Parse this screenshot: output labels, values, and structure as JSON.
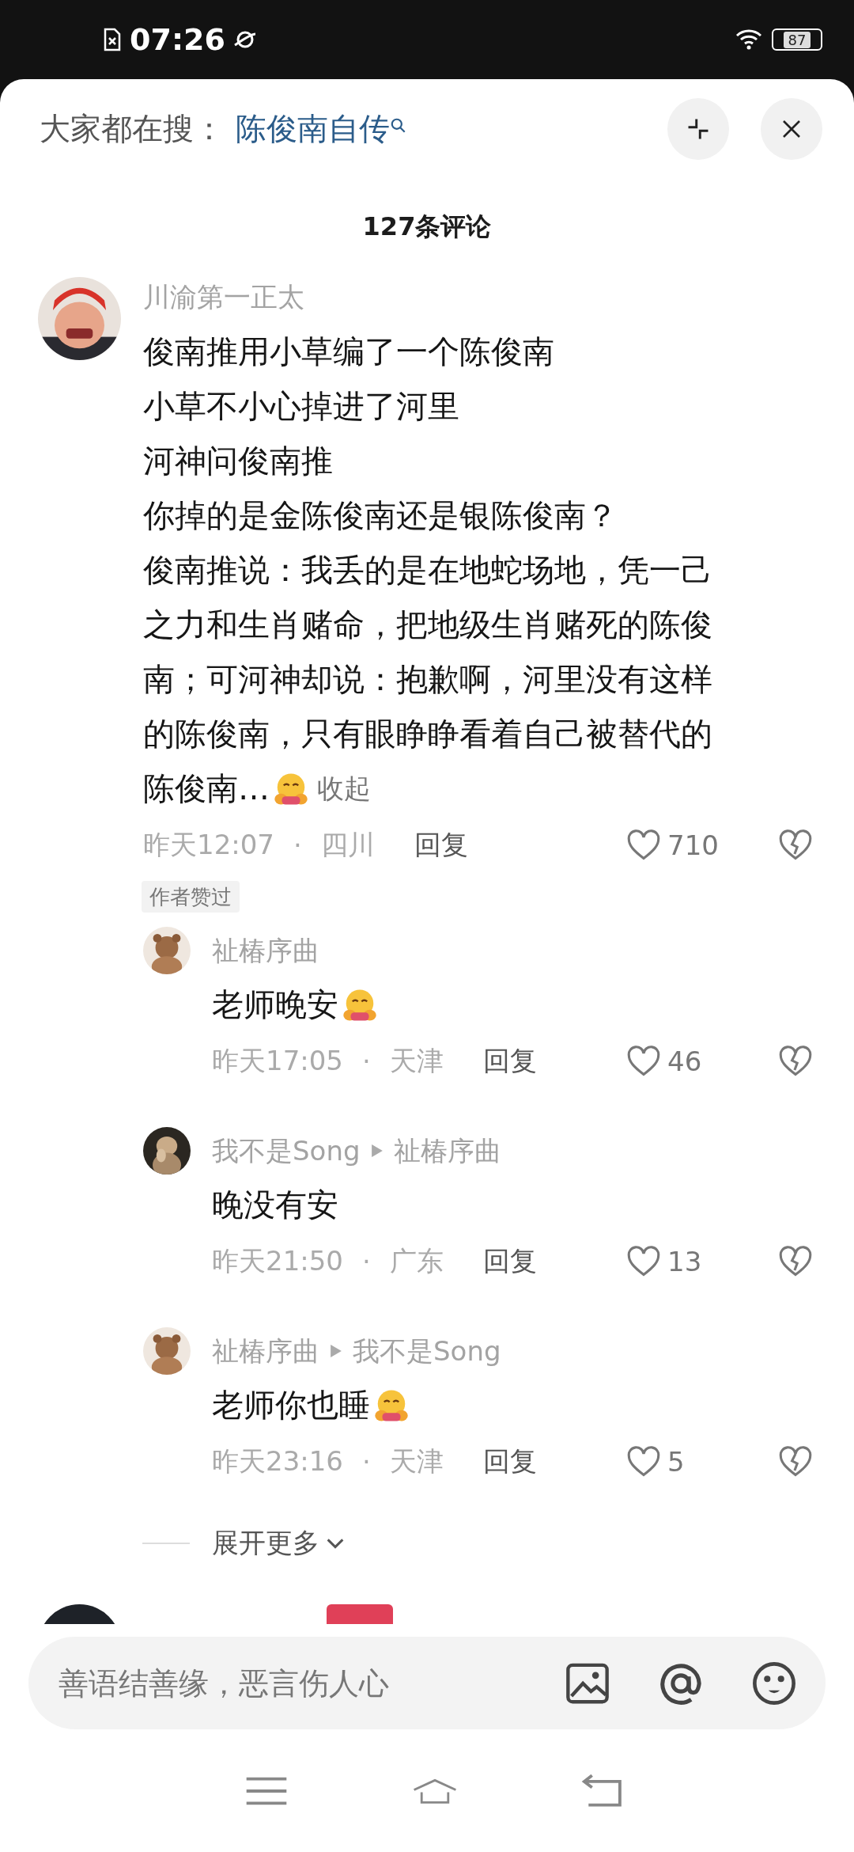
{
  "status_bar": {
    "time": "07:26",
    "battery": "87"
  },
  "header": {
    "label": "大家都在搜：",
    "query": "陈俊南自传"
  },
  "comment_count": "127条评论",
  "comments": [
    {
      "name": "川渝第一正太",
      "lines": [
        "俊南推用小草编了一个陈俊南",
        "小草不小心掉进了河里",
        "河神问俊南推",
        "你掉的是金陈俊南还是银陈俊南？",
        "俊南推说：我丢的是在地蛇场地，凭一己",
        "之力和生肖赌命，把地级生肖赌死的陈俊",
        "南；可河神却说：抱歉啊，河里没有这样",
        "的陈俊南，只有眼睁睁看着自己被替代的",
        "陈俊南…"
      ],
      "emoji": true,
      "collapse": "收起",
      "time": "昨天12:07",
      "separator": "·",
      "location": "四川",
      "reply": "回复",
      "likes": "710",
      "badge": "作者赞过",
      "replies": [
        {
          "name": "祉椿序曲",
          "text": "老师晚安",
          "emoji": true,
          "time": "昨天17:05",
          "separator": "·",
          "location": "天津",
          "reply": "回复",
          "likes": "46"
        },
        {
          "name": "我不是Song",
          "reply_to": "祉椿序曲",
          "text": "晚没有安",
          "emoji": false,
          "time": "昨天21:50",
          "separator": "·",
          "location": "广东",
          "reply": "回复",
          "likes": "13"
        },
        {
          "name": "祉椿序曲",
          "reply_to": "我不是Song",
          "text": "老师你也睡",
          "emoji": true,
          "time": "昨天23:16",
          "separator": "·",
          "location": "天津",
          "reply": "回复",
          "likes": "5"
        }
      ],
      "expand_more": "展开更多"
    }
  ],
  "input": {
    "placeholder": "善语结善缘，恶言伤人心"
  }
}
